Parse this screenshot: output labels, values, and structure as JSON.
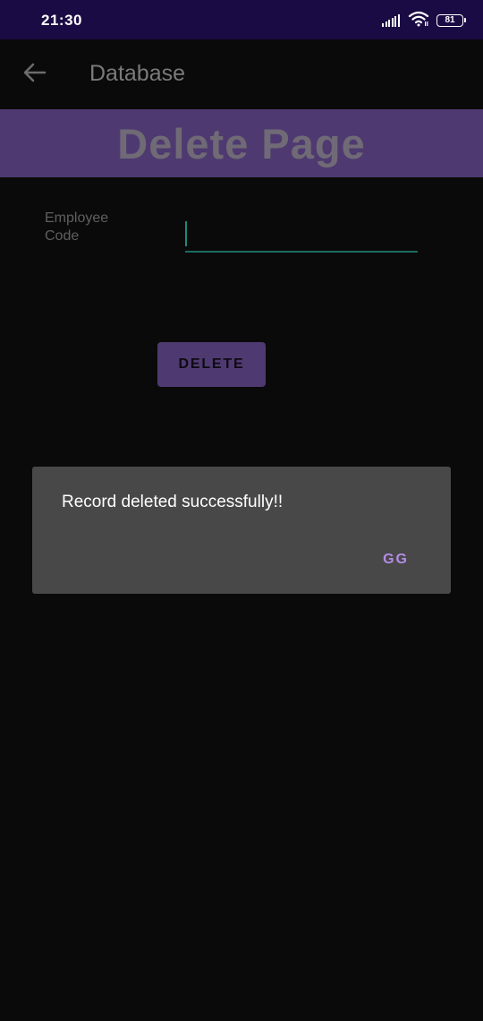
{
  "status_bar": {
    "time": "21:30",
    "battery": "81",
    "icons": [
      "signal-icon",
      "wifi-icon",
      "battery-icon"
    ]
  },
  "app_bar": {
    "back_icon": "arrow-back-icon",
    "title": "Database"
  },
  "banner": {
    "title": "Delete Page"
  },
  "form": {
    "employee_code_label": "Employee Code",
    "employee_code_value": "",
    "delete_button_label": "DELETE"
  },
  "dialog": {
    "message": "Record deleted successfully!!",
    "button_label": "GG"
  },
  "colors": {
    "status_bar_bg": "#1b0b44",
    "banner_bg": "#4e3a70",
    "input_underline": "#1d6b62",
    "dialog_bg": "#484848",
    "dialog_button_text": "#b58be6"
  }
}
